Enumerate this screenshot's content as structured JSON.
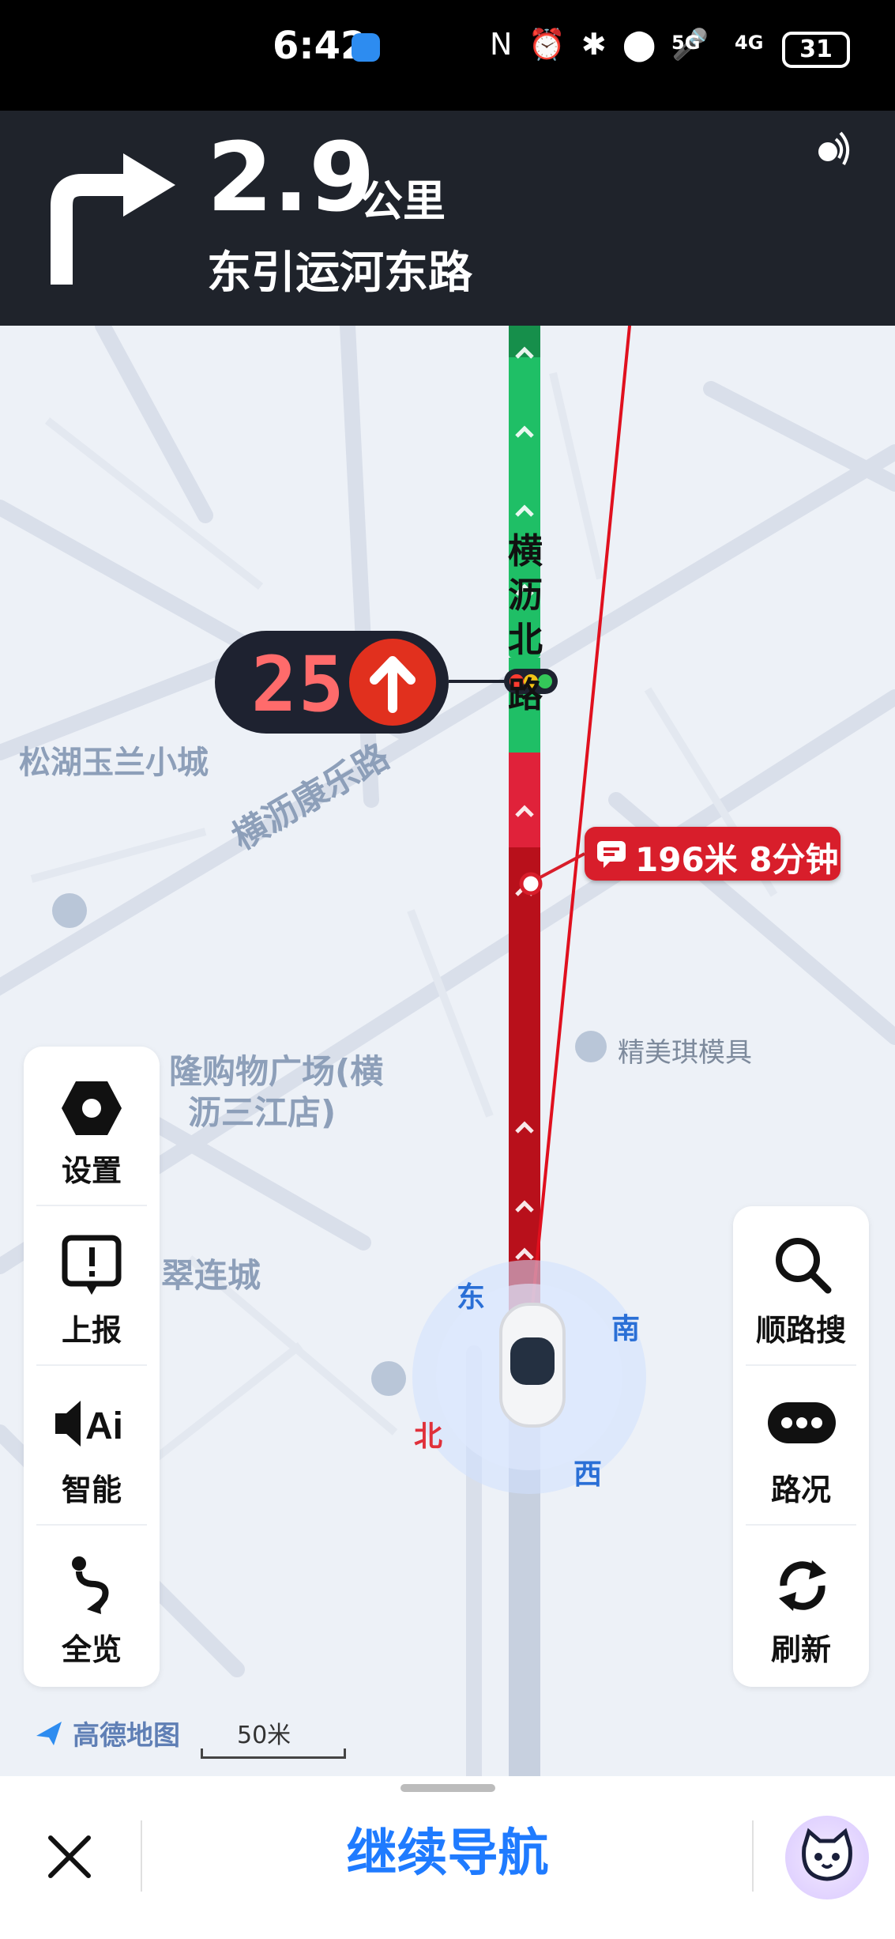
{
  "status_bar": {
    "time": "6:42",
    "icons": "N ⏰ ✱ ⬤ 🎤",
    "network_5g": "5G",
    "network_4g": "4G",
    "battery": "31"
  },
  "nav": {
    "distance": "2.9",
    "distance_unit": "公里",
    "next_road": "东引运河东路",
    "turn_icon": "turn-right-icon"
  },
  "map": {
    "current_road": [
      "横",
      "沥",
      "北",
      "路"
    ],
    "road_label_2": "横沥康乐路",
    "place_1": "松湖玉兰小城",
    "place_2_line1": "隆购物广场(横",
    "place_2_line2": "沥三江店)",
    "place_3": "翠连城",
    "poi_1": "精美琪模具",
    "traffic_light_countdown": "25",
    "jam_info": "196米 8分钟",
    "compass": {
      "east": "东",
      "south": "南",
      "west": "西",
      "north": "北"
    },
    "scale_label": "50米",
    "brand": "高德地图",
    "colors": {
      "route_green": "#1fbf66",
      "route_red": "#c8101e",
      "jam_red": "#d81e2b",
      "accent_blue": "#1f7bff"
    }
  },
  "left_panel": {
    "items": [
      {
        "label": "设置",
        "icon": "gear-icon"
      },
      {
        "label": "上报",
        "icon": "report-icon"
      },
      {
        "label": "智能",
        "icon": "ai-voice-icon"
      },
      {
        "label": "全览",
        "icon": "overview-route-icon"
      }
    ]
  },
  "right_panel": {
    "items": [
      {
        "label": "顺路搜",
        "icon": "search-icon"
      },
      {
        "label": "路况",
        "icon": "traffic-status-icon"
      },
      {
        "label": "刷新",
        "icon": "refresh-icon"
      }
    ]
  },
  "bottom_bar": {
    "continue_label": "继续导航",
    "close_icon": "close-icon",
    "assistant_icon": "assistant-avatar-icon"
  }
}
